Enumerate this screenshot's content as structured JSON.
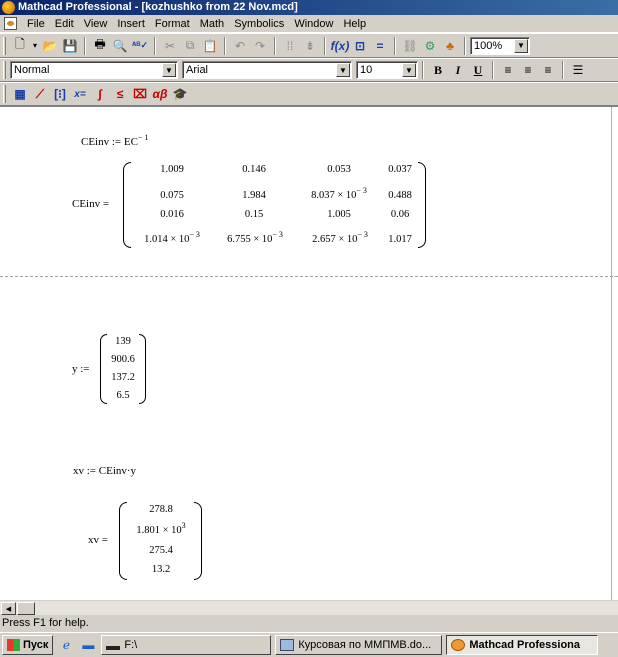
{
  "window": {
    "title": "Mathcad Professional - [kozhushko from 22 Nov.mcd]"
  },
  "menu": [
    "File",
    "Edit",
    "View",
    "Insert",
    "Format",
    "Math",
    "Symbolics",
    "Window",
    "Help"
  ],
  "toolbar": {
    "zoom": "100%"
  },
  "format_bar": {
    "style": "Normal",
    "font": "Arial",
    "size": "10",
    "bold": "B",
    "italic": "I",
    "underline": "U"
  },
  "math_palette": {
    "calculus": "∫",
    "evaluation": "x=",
    "greek": "αβ"
  },
  "worksheet": {
    "cedef": {
      "lhs": "CEinv",
      "op": ":=",
      "rhs": "EC",
      "exp": "− 1"
    },
    "ceres": {
      "lhs": "CEinv =",
      "rows": [
        [
          "1.009",
          "0.146",
          "0.053",
          "0.037"
        ],
        [
          "0.075",
          "1.984",
          "8.037 × 10",
          "0.488"
        ],
        [
          "0.016",
          "0.15",
          "1.005",
          "0.06"
        ],
        [
          "1.014 × 10",
          "6.755 × 10",
          "2.657 × 10",
          "1.017"
        ]
      ],
      "exp": "− 3"
    },
    "ydef": {
      "lhs": "y :=",
      "values": [
        "139",
        "900.6",
        "137.2",
        "6.5"
      ]
    },
    "xvdef": {
      "text": "xv := CEinv·y"
    },
    "xvres": {
      "lhs": "xv =",
      "values": [
        "278.8",
        "1.801 × 10",
        "275.4",
        "13.2"
      ],
      "exp": "3"
    }
  },
  "status": "Press F1 for help.",
  "taskbar": {
    "start": "Пуск",
    "tasks": [
      "F:\\",
      "Курсовая по ММПМВ.do...",
      "Mathcad Professiona"
    ]
  }
}
